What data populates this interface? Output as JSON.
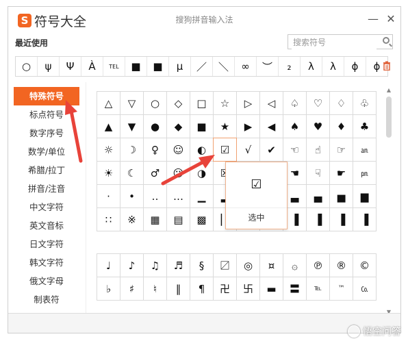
{
  "window": {
    "logo_glyph": "S",
    "title": "符号大全",
    "subtitle": "搜狗拼音输入法",
    "minimize_glyph": "—",
    "close_glyph": "✕"
  },
  "recent": {
    "label": "最近使用",
    "symbols": [
      "○",
      "ψ",
      "Ψ",
      "À",
      "TEL",
      "■",
      "■",
      "μ",
      "／",
      "＼",
      "∞",
      "︶",
      "₂",
      "λ",
      "λ",
      "ϕ",
      "ϕ"
    ],
    "trash_icon": "trash-icon"
  },
  "search": {
    "placeholder": "搜索符号",
    "value": ""
  },
  "sidebar": {
    "items": [
      {
        "label": "特殊符号",
        "active": true
      },
      {
        "label": "标点符号"
      },
      {
        "label": "数字序号"
      },
      {
        "label": "数学/单位"
      },
      {
        "label": "希腊/拉丁"
      },
      {
        "label": "拼音/注音"
      },
      {
        "label": "中文字符"
      },
      {
        "label": "英文音标"
      },
      {
        "label": "日文字符"
      },
      {
        "label": "韩文字符"
      },
      {
        "label": "俄文字母"
      },
      {
        "label": "制表符"
      }
    ]
  },
  "grid1": {
    "rows": [
      [
        "△",
        "▽",
        "○",
        "◇",
        "□",
        "☆",
        "▷",
        "◁",
        "♤",
        "♡",
        "♢",
        "♧"
      ],
      [
        "▲",
        "▼",
        "●",
        "◆",
        "■",
        "★",
        "▶",
        "◀",
        "♠",
        "♥",
        "♦",
        "♣"
      ],
      [
        "☼",
        "☽",
        "♀",
        "☺",
        "◐",
        "☑",
        "√",
        "✔",
        "☜",
        "☝",
        "☞",
        "㏂"
      ],
      [
        "☀",
        "☾",
        "♂",
        "☹",
        "◑",
        "☒",
        "",
        "",
        "☚",
        "☟",
        "☛",
        "㏘"
      ],
      [
        "·",
        "•",
        "‥",
        "…",
        "▁",
        "▂",
        "",
        "",
        "▃",
        "▄",
        "▅",
        "▆"
      ],
      [
        "∷",
        "※",
        "▦",
        "▤",
        "▩",
        "▏",
        "",
        "",
        "▐",
        "▐",
        "▐",
        "▐"
      ]
    ]
  },
  "grid2": {
    "rows": [
      [
        "♩",
        "♪",
        "♫",
        "♬",
        "§",
        "〼",
        "◎",
        "¤",
        "۞",
        "℗",
        "®",
        "©"
      ],
      [
        "♭",
        "♯",
        "♮",
        "‖",
        "¶",
        "卍",
        "卐",
        "▬",
        "〓",
        "℡",
        "™",
        "㏇"
      ]
    ]
  },
  "popup": {
    "symbol": "☑",
    "select_label": "选中"
  },
  "watermark": {
    "text": "悟空问答"
  },
  "colors": {
    "accent": "#f26522",
    "arrow": "#e8433a"
  }
}
